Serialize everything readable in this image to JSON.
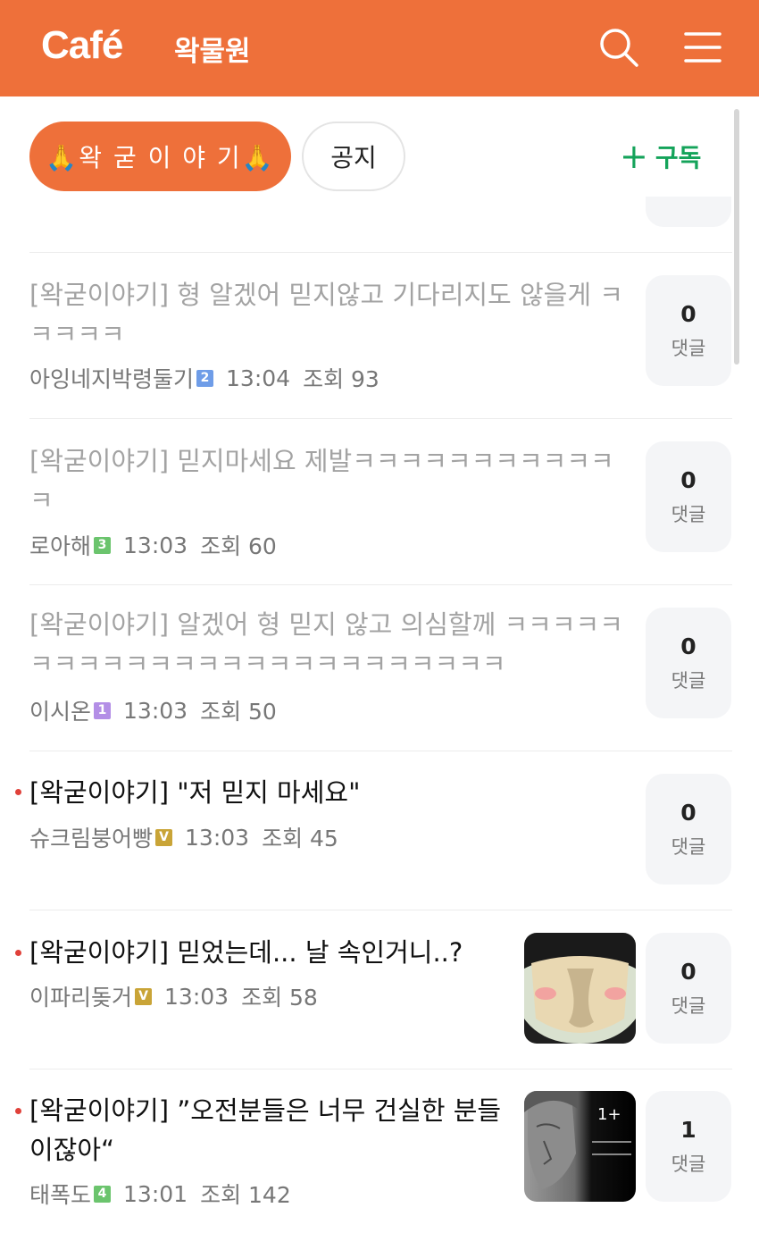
{
  "header": {
    "logo": "Café",
    "cafe_name": "왁물원",
    "icons": [
      "search-icon",
      "menu-icon"
    ],
    "background": "#ee703a"
  },
  "filters": {
    "active_board": "🙏왁 굳 이 야 기🙏",
    "notice": "공지",
    "subscribe_label": "구독",
    "subscribe_color": "#14a35a"
  },
  "posts": [
    {
      "title": "[왁굳이야기] 형 알겠어 믿지않고 기다리지도 않을게 ㅋㅋㅋㅋㅋ",
      "author": "아잉네지박령둘기",
      "level": "2",
      "level_color": "#6f9de8",
      "time": "13:04",
      "views": "조회 93",
      "comments": "0",
      "comment_label": "댓글",
      "read": true
    },
    {
      "title": "[왁굳이야기] 믿지마세요 제발ㅋㅋㅋㅋㅋㅋㅋㅋㅋㅋㅋㅋ",
      "author": "로아해",
      "level": "3",
      "level_color": "#6bc46d",
      "time": "13:03",
      "views": "조회 60",
      "comments": "0",
      "comment_label": "댓글",
      "read": true
    },
    {
      "title": "[왁굳이야기] 알겠어 형 믿지 않고 의심할께 ㅋㅋㅋㅋㅋㅋㅋㅋㅋㅋㅋㅋㅋㅋㅋㅋㅋㅋㅋㅋㅋㅋㅋㅋㅋ",
      "author": "이시온",
      "level": "1",
      "level_color": "#b38ee6",
      "time": "13:03",
      "views": "조회 50",
      "comments": "0",
      "comment_label": "댓글",
      "read": true
    },
    {
      "title": "[왁굳이야기] \"저 믿지 마세요\"",
      "author": "슈크림붕어빵",
      "level": "V",
      "level_color": "#c9a437",
      "time": "13:03",
      "views": "조회 45",
      "comments": "0",
      "comment_label": "댓글",
      "read": false
    },
    {
      "title": "[왁굳이야기] 믿었는데... 날 속인거니..?",
      "author": "이파리돚거",
      "level": "V",
      "level_color": "#c9a437",
      "time": "13:03",
      "views": "조회 58",
      "comments": "0",
      "comment_label": "댓글",
      "read": false
    },
    {
      "title": "[왁굳이야기] ”오전분들은 너무 건실한 분들이잖아“",
      "author": "태폭도",
      "level": "4",
      "level_color": "#6bc46d",
      "time": "13:01",
      "views": "조회 142",
      "comments": "1",
      "comment_label": "댓글",
      "thumb_text": "1+",
      "read": false
    }
  ]
}
